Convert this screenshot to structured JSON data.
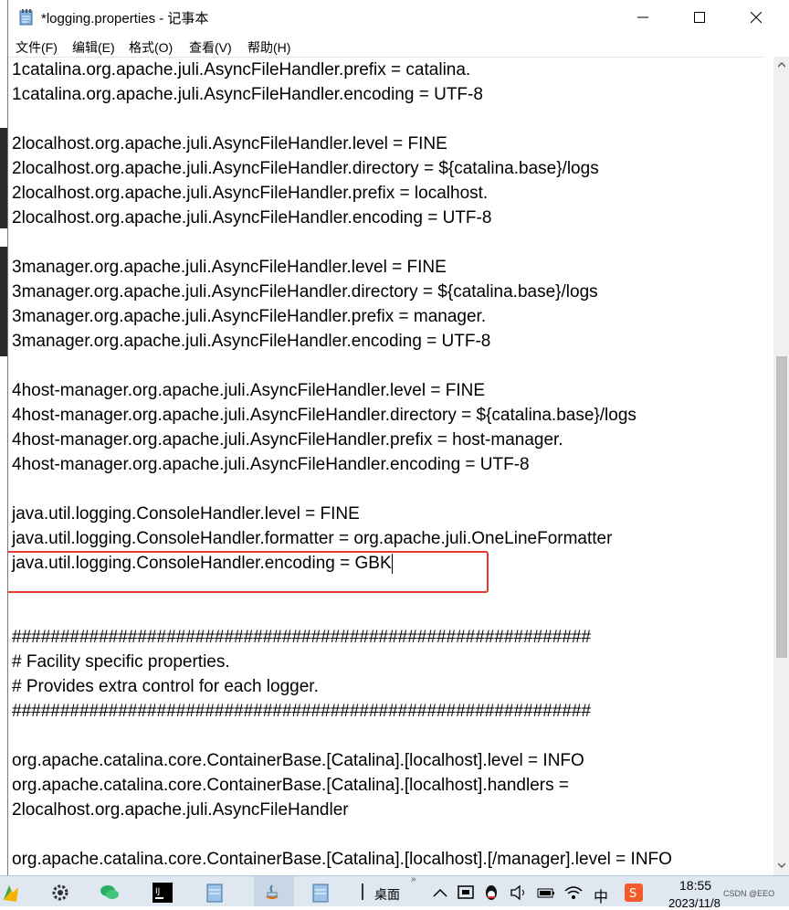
{
  "window": {
    "title": "*logging.properties - 记事本",
    "app_icon": "notepad-icon"
  },
  "menu": [
    {
      "label": "文件(F)"
    },
    {
      "label": "编辑(E)"
    },
    {
      "label": "格式(O)"
    },
    {
      "label": "查看(V)"
    },
    {
      "label": "帮助(H)"
    }
  ],
  "editor": {
    "lines": [
      "1catalina.org.apache.juli.AsyncFileHandler.prefix = catalina.",
      "1catalina.org.apache.juli.AsyncFileHandler.encoding = UTF-8",
      "",
      "2localhost.org.apache.juli.AsyncFileHandler.level = FINE",
      "2localhost.org.apache.juli.AsyncFileHandler.directory = ${catalina.base}/logs",
      "2localhost.org.apache.juli.AsyncFileHandler.prefix = localhost.",
      "2localhost.org.apache.juli.AsyncFileHandler.encoding = UTF-8",
      "",
      "3manager.org.apache.juli.AsyncFileHandler.level = FINE",
      "3manager.org.apache.juli.AsyncFileHandler.directory = ${catalina.base}/logs",
      "3manager.org.apache.juli.AsyncFileHandler.prefix = manager.",
      "3manager.org.apache.juli.AsyncFileHandler.encoding = UTF-8",
      "",
      "4host-manager.org.apache.juli.AsyncFileHandler.level = FINE",
      "4host-manager.org.apache.juli.AsyncFileHandler.directory = ${catalina.base}/logs",
      "4host-manager.org.apache.juli.AsyncFileHandler.prefix = host-manager.",
      "4host-manager.org.apache.juli.AsyncFileHandler.encoding = UTF-8",
      "",
      "java.util.logging.ConsoleHandler.level = FINE",
      "java.util.logging.ConsoleHandler.formatter = org.apache.juli.OneLineFormatter",
      "java.util.logging.ConsoleHandler.encoding = GBK",
      "",
      "",
      "############################################################",
      "# Facility specific properties.",
      "# Provides extra control for each logger.",
      "############################################################",
      "",
      "org.apache.catalina.core.ContainerBase.[Catalina].[localhost].level = INFO",
      "org.apache.catalina.core.ContainerBase.[Catalina].[localhost].handlers =",
      "2localhost.org.apache.juli.AsyncFileHandler",
      "",
      "org.apache.catalina.core.ContainerBase.[Catalina].[localhost].[/manager].level = INFO"
    ],
    "highlighted_line": 20
  },
  "taskbar": {
    "apps": [
      "color-logo-icon",
      "settings-gear-icon",
      "wechat-icon",
      "intellij-icon",
      "notepad-icon",
      "java-icon",
      "notepad-icon"
    ],
    "desktop_label": "桌面",
    "tray_icons": [
      "expand-icon",
      "chevron-up-icon",
      "screen-icon",
      "qq-icon",
      "volume-icon",
      "battery-icon",
      "wifi-icon",
      "ime-icon",
      "sogou-icon"
    ],
    "ime_label": "中",
    "time": "18:55",
    "date": "2023/11/8",
    "watermark": "CSDN @EEO"
  },
  "colors": {
    "highlight": "#e53935",
    "taskbar": "#dfe7f1"
  }
}
